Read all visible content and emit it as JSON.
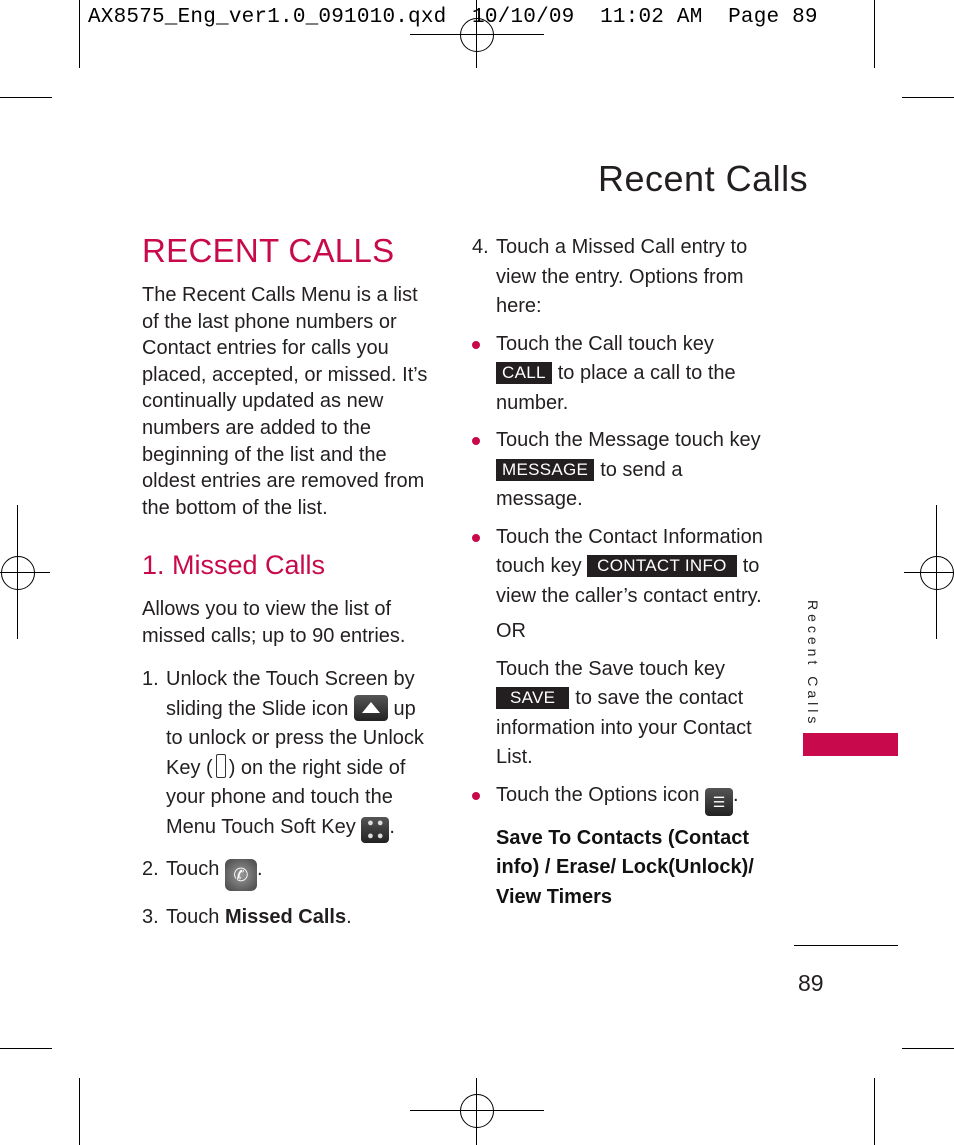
{
  "slug": "AX8575_Eng_ver1.0_091010.qxd  10/10/09  11:02 AM  Page 89",
  "header": {
    "title": "Recent Calls"
  },
  "side_tab": {
    "label": "Recent Calls",
    "accent": "#c8094b"
  },
  "page_number": "89",
  "left": {
    "heading": "RECENT CALLS",
    "intro": "The Recent Calls Menu is a list of the last phone numbers or Contact entries for calls you placed, accepted, or missed. It’s continually updated as new numbers are added to the beginning of the list and the oldest entries are removed from the bottom of the list.",
    "section_heading": "1. Missed Calls",
    "section_intro": "Allows you to view the list of missed calls; up to 90 entries.",
    "steps": [
      {
        "num": "1.",
        "a": "Unlock the Touch Screen by sliding the Slide icon",
        "b": "up to unlock or press the Unlock Key (",
        "c": ") on the right side of your phone and touch the Menu Touch Soft Key",
        "d": "."
      },
      {
        "num": "2.",
        "a": "Touch",
        "b": "."
      },
      {
        "num": "3.",
        "a": "Touch ",
        "bold": "Missed Calls",
        "b": "."
      }
    ]
  },
  "right": {
    "step4": {
      "num": "4.",
      "text": "Touch a Missed Call entry to view the entry. Options from here:"
    },
    "bullets": [
      {
        "a": "Touch the Call touch key",
        "key": "CALL",
        "b": "to place a call to the number."
      },
      {
        "a": "Touch the Message touch key",
        "key": "MESSAGE",
        "b": "to send a message."
      },
      {
        "a": "Touch the Contact Information touch key",
        "key": "CONTACT INFO",
        "b": "to view the caller’s contact entry."
      }
    ],
    "or": "OR",
    "save": {
      "a": "Touch the Save touch key",
      "key": "SAVE",
      "b": "to save the contact information into your Contact List."
    },
    "options": {
      "a": "Touch the Options icon",
      "b": "."
    },
    "options_list": "Save To Contacts (Contact info) / Erase/ Lock(Unlock)/ View Timers"
  }
}
